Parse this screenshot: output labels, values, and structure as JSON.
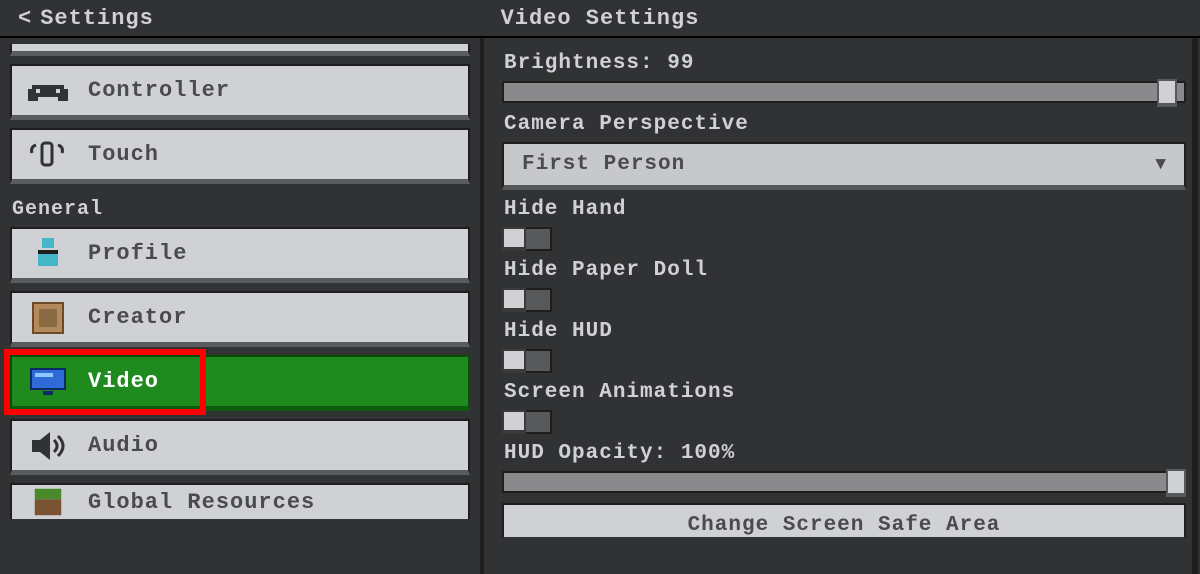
{
  "header": {
    "back_label": "Settings",
    "page_title": "Video Settings"
  },
  "sidebar": {
    "section_label": "General",
    "items": {
      "controller": "Controller",
      "touch": "Touch",
      "profile": "Profile",
      "creator": "Creator",
      "video": "Video",
      "audio": "Audio",
      "global_resources": "Global Resources"
    }
  },
  "panel": {
    "brightness_label": "Brightness: 99",
    "brightness_value": 99,
    "camera_label": "Camera Perspective",
    "camera_value": "First Person",
    "hide_hand_label": "Hide Hand",
    "hide_hand_on": false,
    "hide_paper_doll_label": "Hide Paper Doll",
    "hide_paper_doll_on": false,
    "hide_hud_label": "Hide HUD",
    "hide_hud_on": false,
    "screen_anim_label": "Screen Animations",
    "screen_anim_on": false,
    "hud_opacity_label": "HUD Opacity: 100%",
    "hud_opacity_value": 100,
    "bottom_button_label": "Change Screen Safe Area"
  }
}
